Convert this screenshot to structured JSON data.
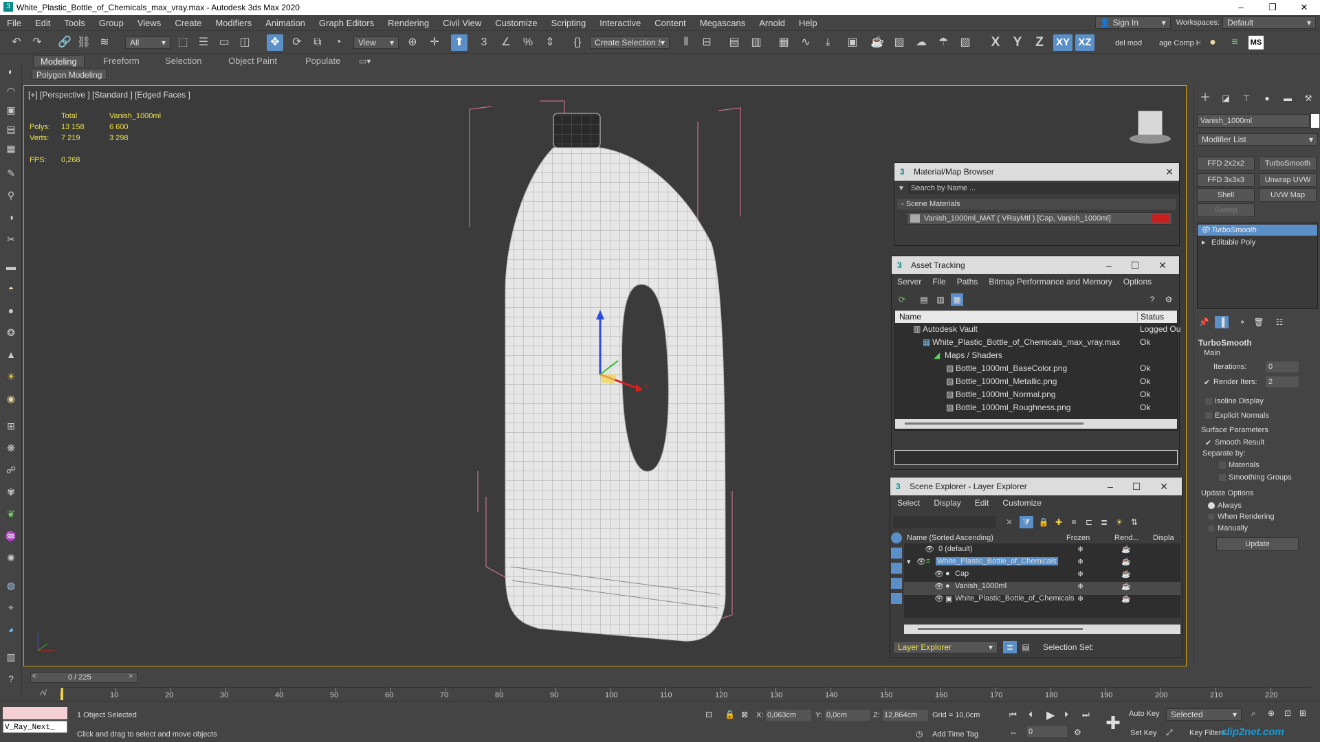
{
  "window": {
    "title": "White_Plastic_Bottle_of_Chemicals_max_vray.max - Autodesk 3ds Max 2020",
    "minimize": "–",
    "maximize": "❐",
    "close": "✕"
  },
  "menu": {
    "items": [
      "File",
      "Edit",
      "Tools",
      "Group",
      "Views",
      "Create",
      "Modifiers",
      "Animation",
      "Graph Editors",
      "Rendering",
      "Civil View",
      "Customize",
      "Scripting",
      "Interactive",
      "Content",
      "Megascans",
      "Arnold",
      "Help"
    ],
    "sign_in": "Sign In",
    "workspaces_label": "Workspaces:",
    "workspace_value": "Default"
  },
  "toolbar": {
    "filter_value": "All",
    "refcoord_value": "View",
    "selection_set": "Create Selection Se",
    "axis_x": "X",
    "axis_y": "Y",
    "axis_z": "Z",
    "axis_xy": "XY",
    "axis_xz": "XZ",
    "del_mod": "del mod",
    "age_comp": "age Comp Help",
    "ms": "MS"
  },
  "ribbon": {
    "tabs": [
      "Modeling",
      "Freeform",
      "Selection",
      "Object Paint",
      "Populate"
    ],
    "sub_label": "Polygon Modeling"
  },
  "viewport": {
    "label": "[+] [Perspective ] [Standard ] [Edged Faces ]",
    "stats": {
      "total_label": "Total",
      "object_label": "Vanish_1000ml",
      "polys_label": "Polys:",
      "polys_total": "13 158",
      "polys_object": "6 600",
      "verts_label": "Verts:",
      "verts_total": "7 219",
      "verts_object": "3 298",
      "fps_label": "FPS:",
      "fps_value": "0,268"
    },
    "gizmo_x": "x"
  },
  "material_browser": {
    "title": "Material/Map Browser",
    "search_placeholder": "Search by Name ...",
    "section": "- Scene Materials",
    "item": "Vanish_1000ml_MAT  ( VRayMtl )  [Cap, Vanish_1000ml]"
  },
  "asset_tracking": {
    "title": "Asset Tracking",
    "menu": [
      "Server",
      "File",
      "Paths",
      "Bitmap Performance and Memory",
      "Options"
    ],
    "col_name": "Name",
    "col_status": "Status",
    "rows": [
      {
        "name": "Autodesk Vault",
        "status": "Logged Ou"
      },
      {
        "name": "White_Plastic_Bottle_of_Chemicals_max_vray.max",
        "status": "Ok"
      },
      {
        "name": "Maps / Shaders",
        "status": ""
      },
      {
        "name": "Bottle_1000ml_BaseColor.png",
        "status": "Ok"
      },
      {
        "name": "Bottle_1000ml_Metallic.png",
        "status": "Ok"
      },
      {
        "name": "Bottle_1000ml_Normal.png",
        "status": "Ok"
      },
      {
        "name": "Bottle_1000ml_Roughness.png",
        "status": "Ok"
      }
    ]
  },
  "scene_explorer": {
    "title": "Scene Explorer - Layer Explorer",
    "menu": [
      "Select",
      "Display",
      "Edit",
      "Customize"
    ],
    "col_name": "Name (Sorted Ascending)",
    "col_frozen": "Frozen",
    "col_render": "Rend...",
    "col_display": "Displa",
    "rows": [
      {
        "name": "0 (default)"
      },
      {
        "name": "White_Plastic_Bottle_of_Chemicals"
      },
      {
        "name": "Cap"
      },
      {
        "name": "Vanish_1000ml"
      },
      {
        "name": "White_Plastic_Bottle_of_Chemicals"
      }
    ],
    "footer_dropdown": "Layer Explorer",
    "selection_set": "Selection Set:"
  },
  "command_panel": {
    "object_name": "Vanish_1000ml",
    "modifier_list": "Modifier List",
    "buttons": [
      "FFD 2x2x2",
      "TurboSmooth",
      "FFD 3x3x3",
      "Unwrap UVW",
      "Shell",
      "UVW Map",
      "Sweep"
    ],
    "stack": [
      "TurboSmooth",
      "Editable Poly"
    ],
    "rollout_title": "TurboSmooth",
    "main_label": "Main",
    "iterations_label": "Iterations:",
    "iterations_value": "0",
    "render_iters_label": "Render Iters:",
    "render_iters_value": "2",
    "isoline": "Isoline Display",
    "explicit_normals": "Explicit Normals",
    "surface_params": "Surface Parameters",
    "smooth_result": "Smooth Result",
    "separate_by": "Separate by:",
    "materials": "Materials",
    "smoothing_groups": "Smoothing Groups",
    "update_options": "Update Options",
    "always": "Always",
    "when_rendering": "When Rendering",
    "manually": "Manually",
    "update_button": "Update"
  },
  "timeline": {
    "frame_counter": "0 / 225",
    "ticks": [
      "0",
      "10",
      "20",
      "30",
      "40",
      "50",
      "60",
      "70",
      "80",
      "90",
      "100",
      "110",
      "120",
      "130",
      "140",
      "150",
      "160",
      "170",
      "180",
      "190",
      "200",
      "210",
      "220"
    ]
  },
  "status": {
    "script_listener": "V_Ray_Next_",
    "objects_selected": "1 Object Selected",
    "prompt": "Click and drag to select and move objects",
    "x_label": "X:",
    "x_value": "0,063cm",
    "y_label": "Y:",
    "y_value": "0,0cm",
    "z_label": "Z:",
    "z_value": "12,864cm",
    "grid": "Grid = 10,0cm",
    "add_time_tag": "Add Time Tag",
    "auto_key": "Auto Key",
    "selected": "Selected",
    "set_key": "Set Key",
    "key_filters": "Key Filters...",
    "frame_value": "0",
    "watermark": "clip2net.com"
  }
}
